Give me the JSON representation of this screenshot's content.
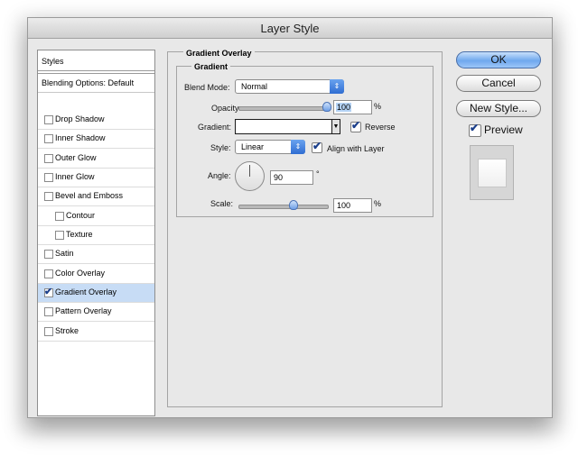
{
  "window": {
    "title": "Layer Style"
  },
  "styles_panel": {
    "header": "Styles",
    "blending_options": "Blending Options: Default",
    "items": [
      {
        "label": "Drop Shadow",
        "checked": false,
        "sub": false,
        "selected": false
      },
      {
        "label": "Inner Shadow",
        "checked": false,
        "sub": false,
        "selected": false
      },
      {
        "label": "Outer Glow",
        "checked": false,
        "sub": false,
        "selected": false
      },
      {
        "label": "Inner Glow",
        "checked": false,
        "sub": false,
        "selected": false
      },
      {
        "label": "Bevel and Emboss",
        "checked": false,
        "sub": false,
        "selected": false
      },
      {
        "label": "Contour",
        "checked": false,
        "sub": true,
        "selected": false
      },
      {
        "label": "Texture",
        "checked": false,
        "sub": true,
        "selected": false
      },
      {
        "label": "Satin",
        "checked": false,
        "sub": false,
        "selected": false
      },
      {
        "label": "Color Overlay",
        "checked": false,
        "sub": false,
        "selected": false
      },
      {
        "label": "Gradient Overlay",
        "checked": true,
        "sub": false,
        "selected": true
      },
      {
        "label": "Pattern Overlay",
        "checked": false,
        "sub": false,
        "selected": false
      },
      {
        "label": "Stroke",
        "checked": false,
        "sub": false,
        "selected": false
      }
    ]
  },
  "gradient_overlay": {
    "group_title": "Gradient Overlay",
    "subgroup_title": "Gradient",
    "blend_mode": {
      "label": "Blend Mode:",
      "value": "Normal"
    },
    "opacity": {
      "label": "Opacity:",
      "value": "100",
      "unit": "%",
      "slider_level": 1.0
    },
    "gradient": {
      "label": "Gradient:",
      "reverse_label": "Reverse",
      "reverse_checked": true
    },
    "style": {
      "label": "Style:",
      "value": "Linear",
      "align_label": "Align with Layer",
      "align_checked": true
    },
    "angle": {
      "label": "Angle:",
      "value": "90",
      "unit": "°"
    },
    "scale": {
      "label": "Scale:",
      "value": "100",
      "unit": "%",
      "slider_level": 0.6
    }
  },
  "buttons": {
    "ok": "OK",
    "cancel": "Cancel",
    "new_style": "New Style...",
    "preview_label": "Preview",
    "preview_checked": true
  },
  "colors": {
    "default_button": "#6fa8ee",
    "selection": "#c7dcf5",
    "window_bg": "#e8e8e8"
  }
}
